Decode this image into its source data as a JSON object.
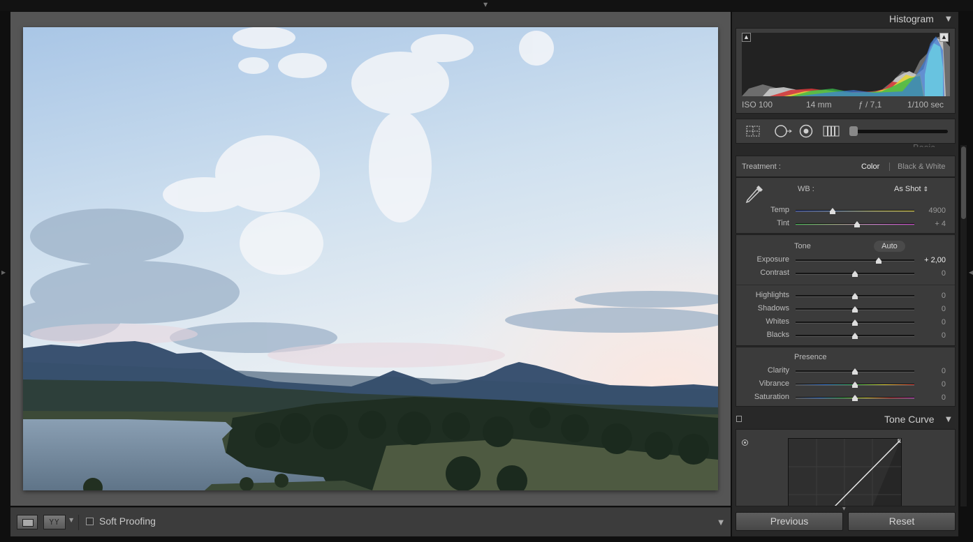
{
  "histogram": {
    "title": "Histogram",
    "exif": {
      "iso": "ISO 100",
      "focal": "14 mm",
      "aperture": "ƒ / 7,1",
      "shutter": "1/100 sec"
    }
  },
  "basic": {
    "title": "Basic",
    "treatment": {
      "label": "Treatment :",
      "color": "Color",
      "bw": "Black & White"
    },
    "wb": {
      "label": "WB :",
      "value": "As Shot",
      "value_caret": "⇕"
    },
    "temp": {
      "label": "Temp",
      "value": "4900",
      "position": 0.31
    },
    "tint": {
      "label": "Tint",
      "value": "+ 4",
      "position": 0.52
    },
    "tone": {
      "heading": "Tone",
      "auto": "Auto",
      "exposure": {
        "label": "Exposure",
        "value": "+ 2,00",
        "position": 0.7
      },
      "contrast": {
        "label": "Contrast",
        "value": "0",
        "position": 0.5
      },
      "highlights": {
        "label": "Highlights",
        "value": "0",
        "position": 0.5
      },
      "shadows": {
        "label": "Shadows",
        "value": "0",
        "position": 0.5
      },
      "whites": {
        "label": "Whites",
        "value": "0",
        "position": 0.5
      },
      "blacks": {
        "label": "Blacks",
        "value": "0",
        "position": 0.5
      }
    },
    "presence": {
      "heading": "Presence",
      "clarity": {
        "label": "Clarity",
        "value": "0",
        "position": 0.5
      },
      "vibrance": {
        "label": "Vibrance",
        "value": "0",
        "position": 0.5
      },
      "saturation": {
        "label": "Saturation",
        "value": "0",
        "position": 0.5
      }
    }
  },
  "tone_curve": {
    "title": "Tone Curve"
  },
  "nav": {
    "previous": "Previous",
    "reset": "Reset"
  },
  "toolbar": {
    "view_mode": "YY",
    "soft_proofing": "Soft Proofing"
  },
  "colors": {
    "panel_bg": "#282828",
    "section_bg": "#3b3b3b",
    "canvas_bg": "#555555"
  }
}
